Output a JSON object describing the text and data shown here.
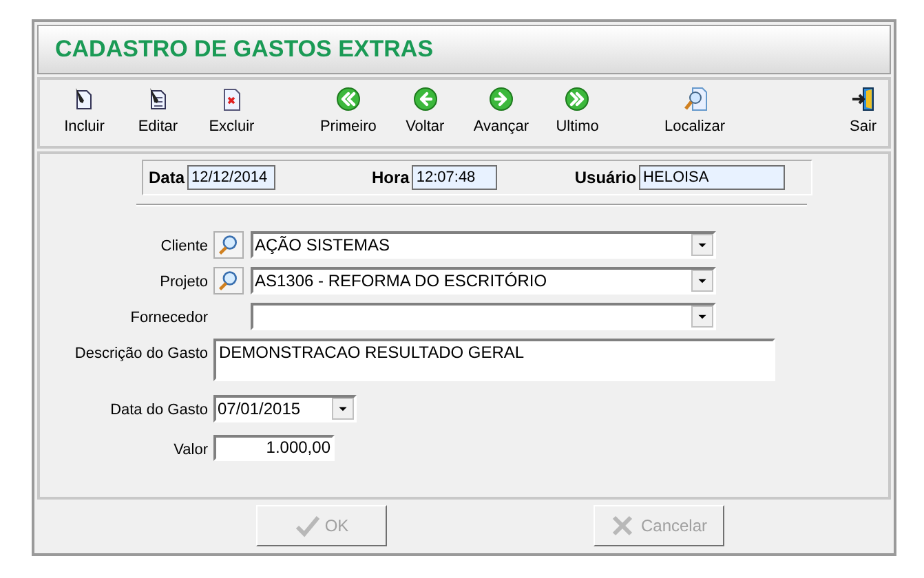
{
  "window": {
    "title": "CADASTRO DE GASTOS EXTRAS"
  },
  "toolbar": [
    {
      "label": "Incluir",
      "kind": "new"
    },
    {
      "label": "Editar",
      "kind": "edit"
    },
    {
      "label": "Excluir",
      "kind": "delete"
    },
    {
      "label": "Primeiro",
      "kind": "first"
    },
    {
      "label": "Voltar",
      "kind": "prev"
    },
    {
      "label": "Avançar",
      "kind": "next"
    },
    {
      "label": "Ultimo",
      "kind": "last"
    },
    {
      "label": "Localizar",
      "kind": "find"
    },
    {
      "label": "Sair",
      "kind": "exit"
    }
  ],
  "header": [
    {
      "label": "Data",
      "value": "12/12/2014"
    },
    {
      "label": "Hora",
      "value": "12:07:48"
    },
    {
      "label": "Usuário",
      "value": "HELOISA"
    }
  ],
  "fields": [
    {
      "label": "Cliente",
      "kind": "lookup",
      "value": "AÇÃO SISTEMAS"
    },
    {
      "label": "Projeto",
      "kind": "lookup",
      "value": "AS1306 - REFORMA DO ESCRITÓRIO"
    },
    {
      "label": "Fornecedor",
      "kind": "combo"
    },
    {
      "label": "Descrição do Gasto",
      "kind": "memo",
      "value": "DEMONSTRACAO RESULTADO GERAL"
    },
    {
      "label": "Data do Gasto",
      "kind": "date",
      "value": "07/01/2015"
    },
    {
      "label": "Valor",
      "kind": "money",
      "value": "1.000,00"
    }
  ],
  "buttons": [
    {
      "label": "OK",
      "kind": "ok",
      "disabled": true
    },
    {
      "label": "Cancelar",
      "kind": "cancel",
      "disabled": true
    }
  ]
}
